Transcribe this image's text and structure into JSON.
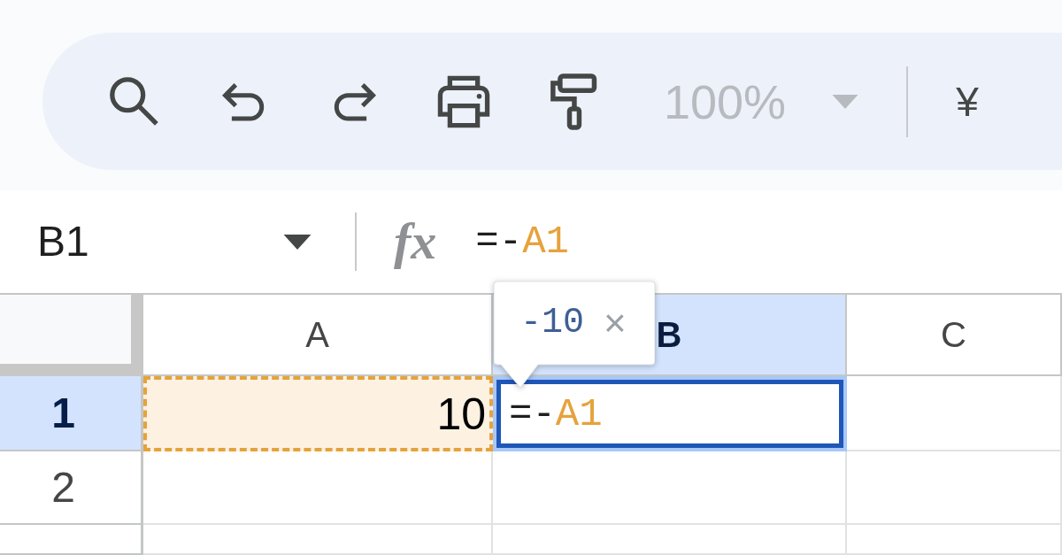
{
  "toolbar": {
    "zoom": {
      "value": "100%",
      "disabled": true
    },
    "currency": "¥"
  },
  "formula_bar": {
    "cell_ref": "B1",
    "function_label": "fx",
    "formula": [
      {
        "kind": "operator",
        "text": "=-"
      },
      {
        "kind": "reference",
        "text": "A1",
        "color": "#e6a23c"
      }
    ]
  },
  "grid": {
    "columns": [
      {
        "label": "A",
        "selected": false
      },
      {
        "label": "B",
        "selected": true
      },
      {
        "label": "C",
        "selected": false
      }
    ],
    "rows": [
      {
        "label": "1",
        "selected": true,
        "cells": [
          {
            "value": "10",
            "referenced": true,
            "selected": false
          },
          {
            "formula": [
              {
                "kind": "operator",
                "text": "=-"
              },
              {
                "kind": "reference",
                "text": "A1",
                "color": "#e6a23c"
              }
            ],
            "referenced": false,
            "selected": true
          },
          {
            "referenced": false,
            "selected": false
          }
        ]
      },
      {
        "label": "2",
        "selected": false,
        "cells": [
          {
            "referenced": false,
            "selected": false
          },
          {
            "referenced": false,
            "selected": false
          },
          {
            "referenced": false,
            "selected": false
          }
        ]
      },
      {
        "selected": false,
        "cells": [
          {
            "referenced": false,
            "selected": false
          },
          {
            "referenced": false,
            "selected": false
          },
          {
            "referenced": false,
            "selected": false
          }
        ]
      }
    ]
  },
  "tooltip": {
    "value": "-10",
    "close": "×"
  }
}
